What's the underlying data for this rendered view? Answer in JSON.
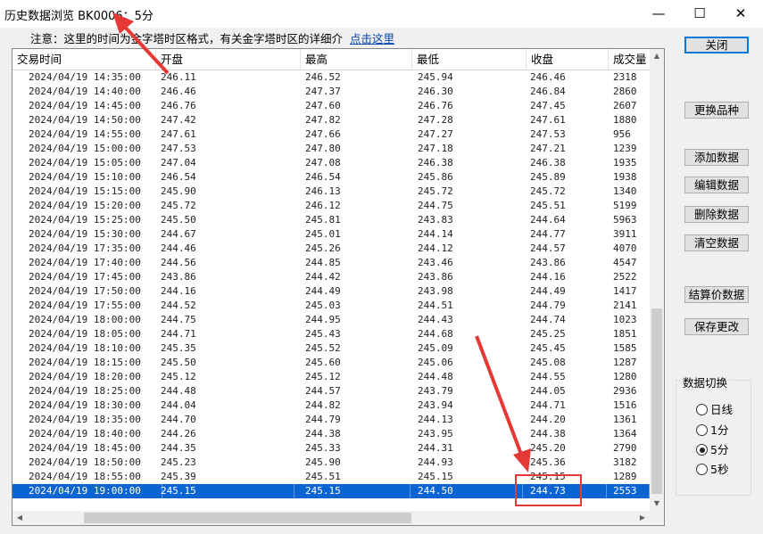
{
  "window": {
    "title": "历史数据浏览 BK0006：5分",
    "controls": {
      "minimize": "—",
      "maximize": "☐",
      "close": "✕"
    }
  },
  "notice": {
    "text": "注意：这里的时间为金字塔时区格式，有关金字塔时区的详细介",
    "link": "点击这里"
  },
  "grid": {
    "columns": [
      "交易时间",
      "开盘",
      "最高",
      "最低",
      "收盘",
      "成交量"
    ],
    "rows": [
      [
        "2024/04/19 14:35:00",
        "246.11",
        "246.52",
        "245.94",
        "246.46",
        "2318"
      ],
      [
        "2024/04/19 14:40:00",
        "246.46",
        "247.37",
        "246.30",
        "246.84",
        "2860"
      ],
      [
        "2024/04/19 14:45:00",
        "246.76",
        "247.60",
        "246.76",
        "247.45",
        "2607"
      ],
      [
        "2024/04/19 14:50:00",
        "247.42",
        "247.82",
        "247.28",
        "247.61",
        "1880"
      ],
      [
        "2024/04/19 14:55:00",
        "247.61",
        "247.66",
        "247.27",
        "247.53",
        "956"
      ],
      [
        "2024/04/19 15:00:00",
        "247.53",
        "247.80",
        "247.18",
        "247.21",
        "1239"
      ],
      [
        "2024/04/19 15:05:00",
        "247.04",
        "247.08",
        "246.38",
        "246.38",
        "1935"
      ],
      [
        "2024/04/19 15:10:00",
        "246.54",
        "246.54",
        "245.86",
        "245.89",
        "1938"
      ],
      [
        "2024/04/19 15:15:00",
        "245.90",
        "246.13",
        "245.72",
        "245.72",
        "1340"
      ],
      [
        "2024/04/19 15:20:00",
        "245.72",
        "246.12",
        "244.75",
        "245.51",
        "5199"
      ],
      [
        "2024/04/19 15:25:00",
        "245.50",
        "245.81",
        "243.83",
        "244.64",
        "5963"
      ],
      [
        "2024/04/19 15:30:00",
        "244.67",
        "245.01",
        "244.14",
        "244.77",
        "3911"
      ],
      [
        "2024/04/19 17:35:00",
        "244.46",
        "245.26",
        "244.12",
        "244.57",
        "4070"
      ],
      [
        "2024/04/19 17:40:00",
        "244.56",
        "244.85",
        "243.46",
        "243.86",
        "4547"
      ],
      [
        "2024/04/19 17:45:00",
        "243.86",
        "244.42",
        "243.86",
        "244.16",
        "2522"
      ],
      [
        "2024/04/19 17:50:00",
        "244.16",
        "244.49",
        "243.98",
        "244.49",
        "1417"
      ],
      [
        "2024/04/19 17:55:00",
        "244.52",
        "245.03",
        "244.51",
        "244.79",
        "2141"
      ],
      [
        "2024/04/19 18:00:00",
        "244.75",
        "244.95",
        "244.43",
        "244.74",
        "1023"
      ],
      [
        "2024/04/19 18:05:00",
        "244.71",
        "245.43",
        "244.68",
        "245.25",
        "1851"
      ],
      [
        "2024/04/19 18:10:00",
        "245.35",
        "245.52",
        "245.09",
        "245.45",
        "1585"
      ],
      [
        "2024/04/19 18:15:00",
        "245.50",
        "245.60",
        "245.06",
        "245.08",
        "1287"
      ],
      [
        "2024/04/19 18:20:00",
        "245.12",
        "245.12",
        "244.48",
        "244.55",
        "1280"
      ],
      [
        "2024/04/19 18:25:00",
        "244.48",
        "244.57",
        "243.79",
        "244.05",
        "2936"
      ],
      [
        "2024/04/19 18:30:00",
        "244.04",
        "244.82",
        "243.94",
        "244.71",
        "1516"
      ],
      [
        "2024/04/19 18:35:00",
        "244.70",
        "244.79",
        "244.13",
        "244.20",
        "1361"
      ],
      [
        "2024/04/19 18:40:00",
        "244.26",
        "244.38",
        "243.95",
        "244.38",
        "1364"
      ],
      [
        "2024/04/19 18:45:00",
        "244.35",
        "245.33",
        "244.31",
        "245.20",
        "2790"
      ],
      [
        "2024/04/19 18:50:00",
        "245.23",
        "245.90",
        "244.93",
        "245.36",
        "3182"
      ],
      [
        "2024/04/19 18:55:00",
        "245.39",
        "245.51",
        "245.15",
        "245.15",
        "1289"
      ],
      [
        "2024/04/19 19:00:00",
        "245.15",
        "245.15",
        "244.50",
        "244.73",
        "2553"
      ]
    ],
    "selected_row": 29,
    "highlighted_cell": {
      "row": 29,
      "column": 4
    }
  },
  "buttons": {
    "close": "关闭",
    "change_symbol": "更换品种",
    "add_data": "添加数据",
    "edit_data": "编辑数据",
    "delete_data": "删除数据",
    "clear_data": "清空数据",
    "settlement_data": "结算价数据",
    "save_changes": "保存更改"
  },
  "data_switch": {
    "label": "数据切换",
    "options": [
      "日线",
      "1分",
      "5分",
      "5秒"
    ],
    "selected": "5分"
  },
  "annotation_colors": {
    "arrow": "#e53935",
    "box": "#e53935",
    "selection": "#0a64d2"
  }
}
